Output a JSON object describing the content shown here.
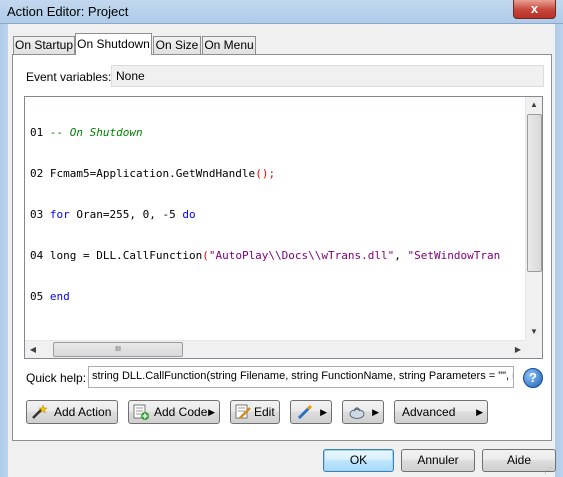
{
  "window": {
    "title": "Action Editor: Project",
    "close_label": "x",
    "close_icon": "close-icon"
  },
  "tabs": [
    {
      "label": "On Startup",
      "active": false
    },
    {
      "label": "On Shutdown",
      "active": true
    },
    {
      "label": "On Size",
      "active": false
    },
    {
      "label": "On Menu",
      "active": false
    }
  ],
  "event_variables": {
    "label": "Event variables:",
    "value": "None"
  },
  "editor": {
    "lines": [
      {
        "num": "01",
        "text": "-- On Shutdown"
      },
      {
        "num": "02",
        "text": "Fcmam5=Application.GetWndHandle();"
      },
      {
        "num": "03",
        "text": "for Oran=255, 0, -5 do"
      },
      {
        "num": "04",
        "text": "long = DLL.CallFunction(\"AutoPlay\\\\Docs\\\\wTrans.dll\", \"SetWindowTran"
      },
      {
        "num": "05",
        "text": "end"
      }
    ],
    "hscroll_grip": "III"
  },
  "quick_help": {
    "label": "Quick help:",
    "value": "string DLL.CallFunction(string Filename, string FunctionName, string Parameters = \"\", num",
    "help_icon": "help-icon"
  },
  "toolbar": {
    "add_action": "Add Action",
    "add_code": "Add Code",
    "edit": "Edit",
    "advanced": "Advanced"
  },
  "buttons": {
    "ok": "OK",
    "annuler": "Annuler",
    "aide": "Aide"
  },
  "colors": {
    "comment": "#008000",
    "keyword": "#0000ff",
    "string": "#800080",
    "punct": "#ff0000",
    "titlebar": "#b9d1ea"
  }
}
